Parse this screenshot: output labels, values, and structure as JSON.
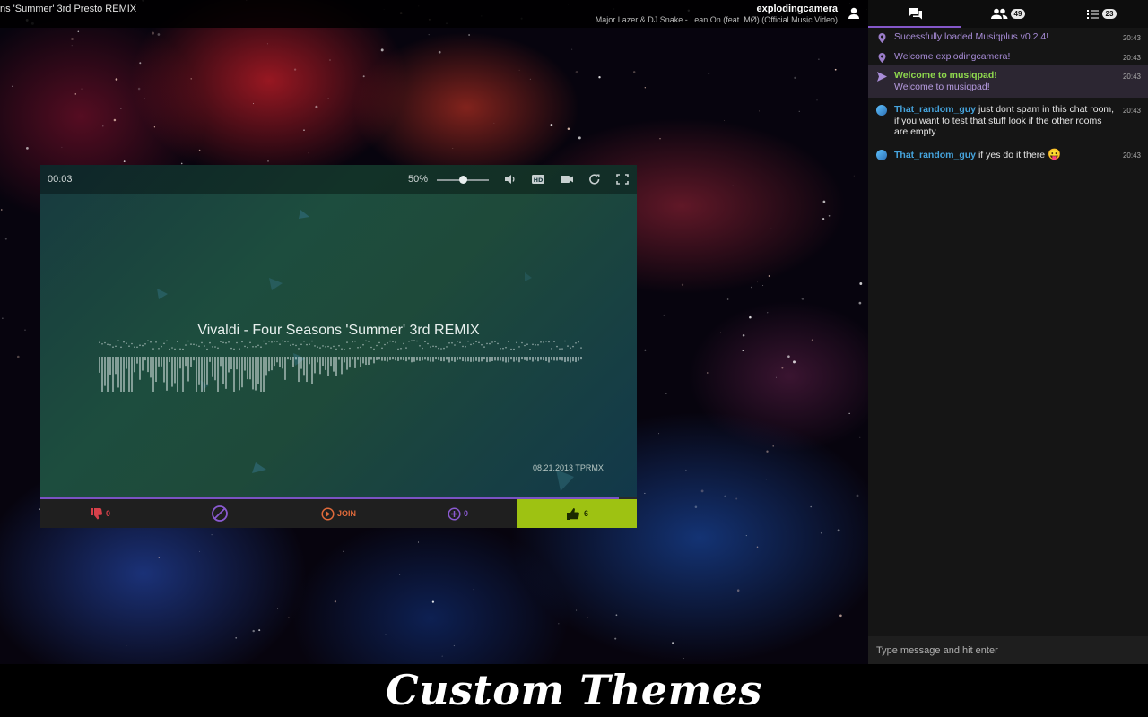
{
  "topbar": {
    "current_title": "ns 'Summer' 3rd Presto REMIX",
    "user_name": "explodingcamera",
    "now_playing": "Major Lazer & DJ Snake - Lean On (feat. MØ) (Official Music Video)",
    "user_icon": "user-icon"
  },
  "player": {
    "time": "00:03",
    "volume_label": "50%",
    "volume": 0.5,
    "video_title": "Vivaldi - Four Seasons 'Summer' 3rd REMIX",
    "date_tag": "08.21.2013 TPRMX",
    "progress": 0.97,
    "controls": {
      "meh_count": "0",
      "join_label": "JOIN",
      "grab_count": "0",
      "woot_count": "6"
    },
    "accent": "#7b52c4",
    "woot_color": "#9ec212"
  },
  "sidebar": {
    "tabs": [
      {
        "icon": "chat-icon",
        "count": ""
      },
      {
        "icon": "users-icon",
        "count": "49"
      },
      {
        "icon": "queue-icon",
        "count": "23"
      }
    ],
    "messages": [
      {
        "type": "system",
        "icon": "pin-icon",
        "text": "Sucessfully loaded Musiqplus v0.2.4!",
        "time": "20:43"
      },
      {
        "type": "system",
        "icon": "pin-icon",
        "text": "Welcome explodingcamera!",
        "time": "20:43"
      },
      {
        "type": "broadcast",
        "icon": "send-icon",
        "title": "Welcome to musiqpad!",
        "text": "Welcome to musiqpad!",
        "time": "20:43"
      },
      {
        "type": "user",
        "user": "That_random_guy",
        "text": "just dont spam in this chat room, if you want to test that stuff look if the other rooms are empty",
        "time": "20:43"
      },
      {
        "type": "user",
        "user": "That_random_guy",
        "text": "if yes do it there",
        "emoji": "😛",
        "time": "20:43"
      }
    ],
    "input_placeholder": "Type message and hit enter"
  },
  "banner": {
    "text": "Custom Themes"
  }
}
